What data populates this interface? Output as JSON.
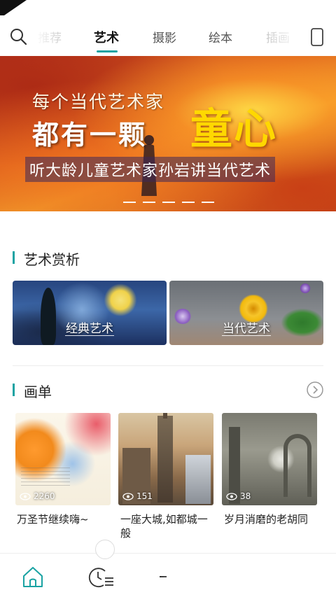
{
  "tabs": [
    {
      "label": "推荐",
      "state": "faded"
    },
    {
      "label": "艺术",
      "state": "active"
    },
    {
      "label": "摄影",
      "state": "normal"
    },
    {
      "label": "绘本",
      "state": "normal"
    },
    {
      "label": "插画",
      "state": "faded"
    }
  ],
  "icons": {
    "search": "search-icon",
    "phone": "phone-icon",
    "home": "home-icon",
    "history": "history-list-icon",
    "more": "chevron-right-circle-icon",
    "views": "eye-icon"
  },
  "banner": {
    "line1": "每个当代艺术家",
    "line2": "都有一颗",
    "highlight": "童心",
    "subtitle": "听大龄儿童艺术家孙岩讲当代艺术",
    "page_dots": 5
  },
  "art_section": {
    "title": "艺术赏析",
    "cards": [
      {
        "label": "经典艺术"
      },
      {
        "label": "当代艺术"
      }
    ]
  },
  "playlist_section": {
    "title": "画单",
    "items": [
      {
        "views": "2260",
        "title": "万圣节继续嗨~"
      },
      {
        "views": "151",
        "title": "一座大城,如都城一般"
      },
      {
        "views": "38",
        "title": "岁月消磨的老胡同"
      }
    ]
  },
  "colors": {
    "accent": "#1aa3a3",
    "highlight_yellow": "#ffd800"
  }
}
